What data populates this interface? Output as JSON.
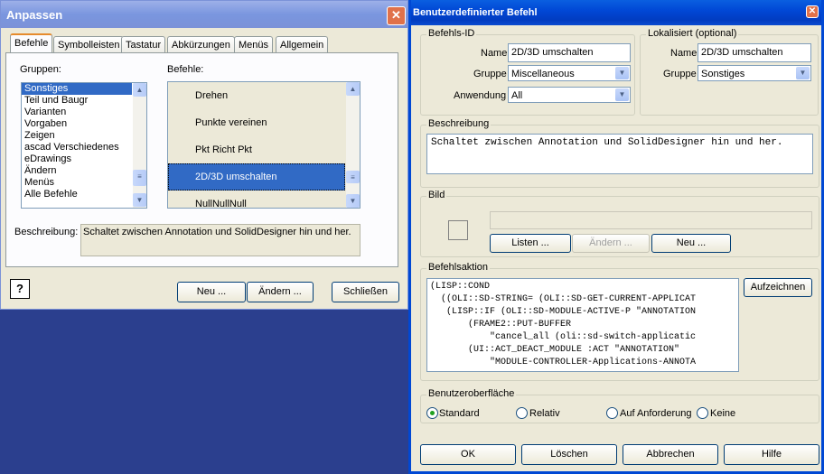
{
  "left_dialog": {
    "title": "Anpassen",
    "tabs": [
      "Befehle",
      "Symbolleisten",
      "Tastatur",
      "Abkürzungen",
      "Menüs",
      "Allgemein"
    ],
    "groups_label": "Gruppen:",
    "groups": [
      "Sonstiges",
      "Teil und Baugr",
      "Varianten",
      "Vorgaben",
      "Zeigen",
      "ascad Verschiedenes",
      "eDrawings",
      "Ändern",
      "Menüs",
      "Alle Befehle"
    ],
    "commands_label": "Befehle:",
    "commands": [
      "Drehen",
      "Punkte vereinen",
      "Pkt Richt Pkt",
      "2D/3D umschalten",
      "NullNullNull"
    ],
    "description_label": "Beschreibung:",
    "description": "Schaltet zwischen Annotation und SolidDesigner hin und her.",
    "help_icon": "?",
    "buttons": {
      "new": "Neu ...",
      "change": "Ändern ...",
      "close": "Schließen"
    }
  },
  "right_dialog": {
    "title": "Benutzerdefinierter Befehl",
    "id_group": {
      "label": "Befehls-ID",
      "name_label": "Name",
      "name": "2D/3D umschalten",
      "group_label": "Gruppe",
      "group": "Miscellaneous",
      "application_label": "Anwendung",
      "application": "All"
    },
    "localized_group": {
      "label": "Lokalisiert (optional)",
      "name_label": "Name",
      "name": "2D/3D umschalten",
      "group_label": "Gruppe",
      "group": "Sonstiges"
    },
    "description_group": {
      "label": "Beschreibung",
      "text": "Schaltet zwischen Annotation und SolidDesigner hin und her."
    },
    "image_group": {
      "label": "Bild",
      "buttons": {
        "list": "Listen ...",
        "change": "Ändern ...",
        "new": "Neu ..."
      }
    },
    "action_group": {
      "label": "Befehlsaktion",
      "record": "Aufzeichnen",
      "lines": [
        "(LISP::COND",
        "  ((OLI::SD-STRING= (OLI::SD-GET-CURRENT-APPLICAT",
        "   (LISP::IF (OLI::SD-MODULE-ACTIVE-P \"ANNOTATION",
        "       (FRAME2::PUT-BUFFER",
        "           \"cancel_all (oli::sd-switch-applicatic",
        "       (UI::ACT_DEACT_MODULE :ACT \"ANNOTATION\"",
        "           \"MODULE-CONTROLLER-Applications-ANNOTA"
      ]
    },
    "ui_group": {
      "label": "Benutzeroberfläche",
      "options": [
        "Standard",
        "Relativ",
        "Auf Anforderung",
        "Keine"
      ],
      "selected": "Standard"
    },
    "buttons": {
      "ok": "OK",
      "delete": "Löschen",
      "cancel": "Abbrechen",
      "help": "Hilfe"
    }
  },
  "colors": {
    "desktop": "#2b3f8e",
    "dialog": "#ece9d8",
    "selection": "#316ac5"
  }
}
